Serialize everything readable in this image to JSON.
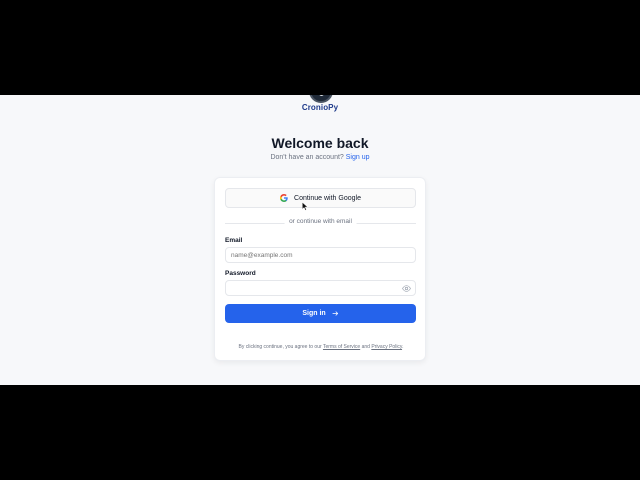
{
  "brand": {
    "name": "CronioPy"
  },
  "heading": "Welcome back",
  "signup_prompt": {
    "text": "Don't have an account?",
    "link": "Sign up"
  },
  "google_button": {
    "label": "Continue with Google",
    "icon": "google-icon"
  },
  "divider_text": "or continue with email",
  "email": {
    "label": "Email",
    "placeholder": "name@example.com",
    "value": ""
  },
  "password": {
    "label": "Password",
    "value": "",
    "icon": "eye-icon"
  },
  "signin_button": {
    "label": "Sign in",
    "icon": "arrow-right-icon"
  },
  "legal": {
    "prefix": "By clicking continue, you agree to our",
    "terms": "Terms of Service",
    "and": "and",
    "privacy": "Privacy Policy",
    "suffix": "."
  },
  "colors": {
    "accent": "#2563eb",
    "brand": "#1e3a8a",
    "background": "#f7f8fa"
  }
}
